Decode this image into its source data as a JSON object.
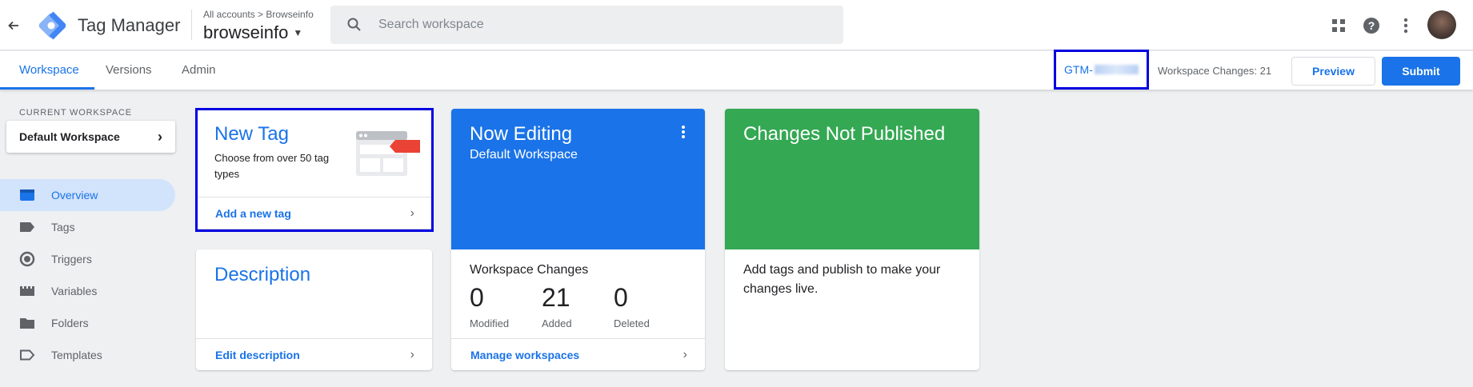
{
  "header": {
    "app_name": "Tag Manager",
    "breadcrumb": "All accounts > Browseinfo",
    "container": "browseinfo",
    "search_placeholder": "Search workspace"
  },
  "icons": [
    "back-arrow-icon",
    "tag-manager-logo-icon",
    "caret-down-icon",
    "search-icon",
    "apps-grid-icon",
    "help-icon",
    "more-vert-icon",
    "avatar"
  ],
  "subnav": {
    "tabs": [
      "Workspace",
      "Versions",
      "Admin"
    ],
    "container_id_prefix": "GTM-",
    "workspace_changes": "Workspace Changes: 21",
    "preview_label": "Preview",
    "submit_label": "Submit"
  },
  "sidebar": {
    "current_workspace_label": "CURRENT WORKSPACE",
    "workspace_name": "Default Workspace",
    "items": [
      {
        "label": "Overview",
        "icon": "overview-icon",
        "active": true
      },
      {
        "label": "Tags",
        "icon": "tag-icon"
      },
      {
        "label": "Triggers",
        "icon": "trigger-icon"
      },
      {
        "label": "Variables",
        "icon": "variable-icon"
      },
      {
        "label": "Folders",
        "icon": "folder-icon"
      },
      {
        "label": "Templates",
        "icon": "template-icon"
      }
    ]
  },
  "cards": {
    "new_tag": {
      "title": "New Tag",
      "desc": "Choose from over 50 tag types",
      "link": "Add a new tag"
    },
    "description": {
      "title": "Description",
      "link": "Edit description"
    },
    "now_editing": {
      "title": "Now Editing",
      "subtitle": "Default Workspace",
      "changes_title": "Workspace Changes",
      "stats": [
        {
          "value": "0",
          "label": "Modified"
        },
        {
          "value": "21",
          "label": "Added"
        },
        {
          "value": "0",
          "label": "Deleted"
        }
      ],
      "link": "Manage workspaces"
    },
    "not_published": {
      "title": "Changes Not Published",
      "body": "Add tags and publish to make your changes live."
    }
  },
  "colors": {
    "accent": "#1a73e8",
    "now_editing_bg": "#1a73e8",
    "not_published_bg": "#34a853",
    "highlight_box": "#0000e0"
  }
}
